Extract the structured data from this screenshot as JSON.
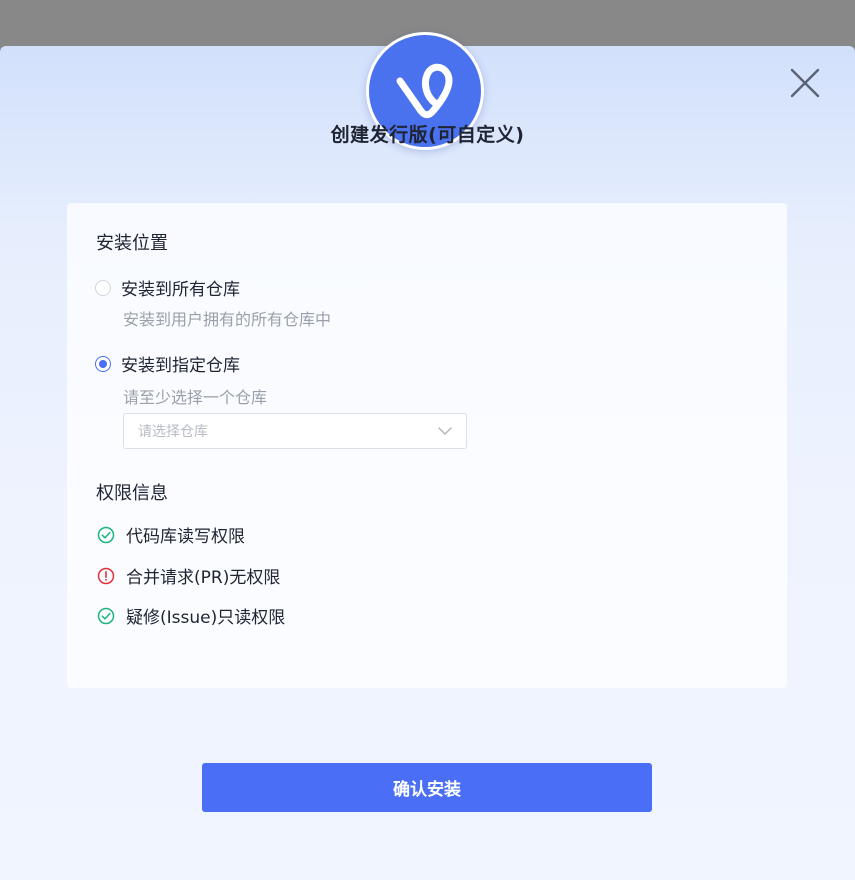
{
  "dialog": {
    "title": "创建发行版(可自定义)",
    "logo_icon": "v-logo-icon",
    "close_icon": "close-icon"
  },
  "install_location": {
    "section_title": "安装位置",
    "options": [
      {
        "label": "安装到所有仓库",
        "description": "安装到用户拥有的所有仓库中",
        "checked": false
      },
      {
        "label": "安装到指定仓库",
        "description": "请至少选择一个仓库",
        "checked": true
      }
    ],
    "repo_select": {
      "placeholder": "请选择仓库",
      "icon": "chevron-down-icon"
    }
  },
  "permissions": {
    "section_title": "权限信息",
    "items": [
      {
        "text": "代码库读写权限",
        "status": "granted",
        "icon": "check-circle-icon",
        "color": "#1fb57a"
      },
      {
        "text": "合并请求(PR)无权限",
        "status": "none",
        "icon": "exclamation-circle-icon",
        "color": "#e0323c"
      },
      {
        "text": "疑修(Issue)只读权限",
        "status": "granted",
        "icon": "check-circle-icon",
        "color": "#1fb57a"
      }
    ]
  },
  "actions": {
    "confirm_label": "确认安装"
  },
  "colors": {
    "primary": "#4a6ef5",
    "logo_bg": "#4b72ee",
    "success": "#1fb57a",
    "danger": "#e0323c"
  }
}
